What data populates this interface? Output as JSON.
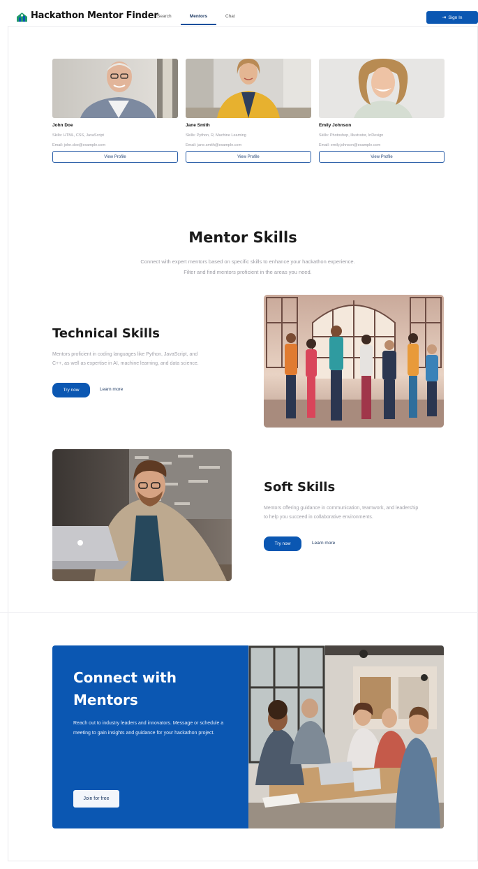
{
  "nav": {
    "brand": "Hackathon Mentor Finder",
    "links": [
      "Search",
      "Mentors",
      "Chat"
    ],
    "active": "Mentors",
    "signin_label": "Sign In",
    "brand_color": "#0b57b2"
  },
  "mentors": [
    {
      "name": "John Doe",
      "skills": "Skills: HTML, CSS, JavaScript",
      "email": "Email: john.doe@example.com",
      "button": "View Profile"
    },
    {
      "name": "Jane Smith",
      "skills": "Skills: Python, R, Machine Learning",
      "email": "Email: jane.smith@example.com",
      "button": "View Profile"
    },
    {
      "name": "Emily Johnson",
      "skills": "Skills: Photoshop, Illustrator, InDesign",
      "email": "Email: emily.johnson@example.com",
      "button": "View Profile"
    }
  ],
  "skills_section": {
    "title": "Mentor Skills",
    "subtitle": "Connect with expert mentors based on specific skills to enhance your hackathon experience. Filter and find mentors proficient in the areas you need."
  },
  "technical": {
    "title": "Technical Skills",
    "text": "Mentors proficient in coding languages like Python, JavaScript, and C++, as well as expertise in AI, machine learning, and data science.",
    "try": "Try now",
    "learn": "Learn more"
  },
  "soft": {
    "title": "Soft Skills",
    "text": "Mentors offering guidance in communication, teamwork, and leadership to help you succeed in collaborative environments.",
    "try": "Try now",
    "learn": "Learn more"
  },
  "connect": {
    "title": "Connect with Mentors",
    "text": "Reach out to industry leaders and innovators. Message or schedule a meeting to gain insights and guidance for your hackathon project.",
    "button": "Join for free"
  }
}
